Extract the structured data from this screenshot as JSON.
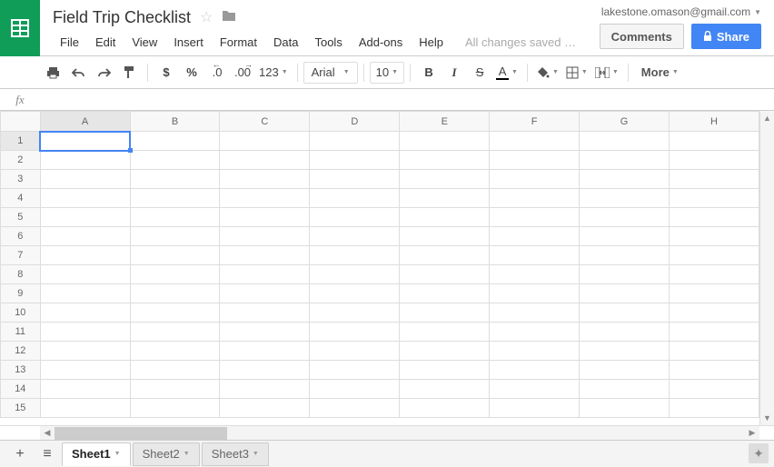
{
  "doc": {
    "title": "Field Trip Checklist"
  },
  "account": {
    "email": "lakestone.omason@gmail.com"
  },
  "status": {
    "save": "All changes saved …"
  },
  "buttons": {
    "comments": "Comments",
    "share": "Share"
  },
  "menu": {
    "file": "File",
    "edit": "Edit",
    "view": "View",
    "insert": "Insert",
    "format": "Format",
    "data": "Data",
    "tools": "Tools",
    "addons": "Add-ons",
    "help": "Help"
  },
  "toolbar": {
    "currency": "$",
    "percent": "%",
    "dec_dec": ".0",
    "dec_inc": ".00",
    "numfmt": "123",
    "font": "Arial",
    "size": "10",
    "bold": "B",
    "italic": "I",
    "strike": "S",
    "textcolor": "A",
    "more": "More"
  },
  "fx": {
    "label": "fx"
  },
  "columns": [
    "A",
    "B",
    "C",
    "D",
    "E",
    "F",
    "G",
    "H"
  ],
  "rows": [
    "1",
    "2",
    "3",
    "4",
    "5",
    "6",
    "7",
    "8",
    "9",
    "10",
    "11",
    "12",
    "13",
    "14",
    "15"
  ],
  "selected": {
    "col": 0,
    "row": 0
  },
  "tabs": {
    "s1": "Sheet1",
    "s2": "Sheet2",
    "s3": "Sheet3"
  }
}
